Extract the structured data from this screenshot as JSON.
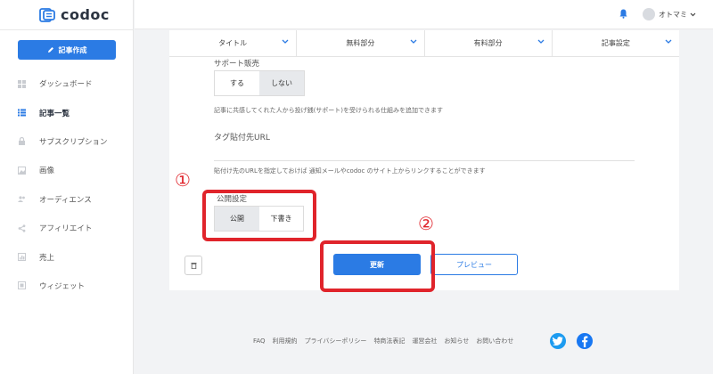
{
  "app": {
    "logo_text": "codoc"
  },
  "sidebar": {
    "create_label": "記事作成",
    "items": [
      {
        "label": "ダッシュボード",
        "icon": "dashboard-icon"
      },
      {
        "label": "記事一覧",
        "icon": "list-icon",
        "active": true
      },
      {
        "label": "サブスクリプション",
        "icon": "lock-icon"
      },
      {
        "label": "画像",
        "icon": "image-icon"
      },
      {
        "label": "オーディエンス",
        "icon": "audience-icon"
      },
      {
        "label": "アフィリエイト",
        "icon": "share-icon"
      },
      {
        "label": "売上",
        "icon": "sales-icon"
      },
      {
        "label": "ウィジェット",
        "icon": "widget-icon"
      }
    ]
  },
  "header": {
    "user_name": "オトマミ"
  },
  "tabs": [
    "タイトル",
    "無料部分",
    "有料部分",
    "記事設定"
  ],
  "support": {
    "label": "サポート販売",
    "options": [
      "する",
      "しない"
    ],
    "selected": "しない",
    "help": "記事に共感してくれた人から投げ銭(サポート)を受けられる仕組みを追加できます"
  },
  "tag_url": {
    "label": "タグ貼付先URL",
    "value": "",
    "help": "貼付け先のURLを指定しておけば 通知メールやcodoc のサイト上からリンクすることができます"
  },
  "publish": {
    "label": "公開設定",
    "options": [
      "公開",
      "下書き"
    ],
    "selected": "公開"
  },
  "actions": {
    "update_label": "更新",
    "preview_label": "プレビュー"
  },
  "annotations": {
    "one": "①",
    "two": "②"
  },
  "footer": {
    "links": [
      "FAQ",
      "利用規約",
      "プライバシーポリシー",
      "特商法表記",
      "運営会社",
      "お知らせ",
      "お問い合わせ"
    ]
  },
  "colors": {
    "primary": "#2b7be4",
    "annotation": "#e0242b",
    "twitter": "#1d9bf0",
    "facebook": "#1877f2"
  }
}
